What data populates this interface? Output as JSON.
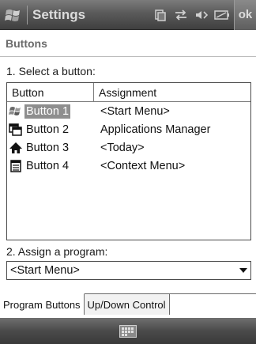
{
  "titlebar": {
    "title": "Settings",
    "ok_label": "ok",
    "icons": [
      "windows-flag-icon",
      "connectivity-icon",
      "data-sync-icon",
      "speaker-icon",
      "battery-icon"
    ]
  },
  "page": {
    "header": "Buttons",
    "select_label": "1. Select a button:",
    "assign_label": "2. Assign a program:"
  },
  "list": {
    "columns": [
      "Button",
      "Assignment"
    ],
    "rows": [
      {
        "name": "Button 1",
        "assignment": "<Start Menu>",
        "icon": "windows-flag-icon",
        "selected": true
      },
      {
        "name": "Button 2",
        "assignment": "Applications Manager",
        "icon": "windows-stack-icon",
        "selected": false
      },
      {
        "name": "Button 3",
        "assignment": "<Today>",
        "icon": "home-icon",
        "selected": false
      },
      {
        "name": "Button 4",
        "assignment": "<Context Menu>",
        "icon": "menu-list-icon",
        "selected": false
      }
    ]
  },
  "dropdown": {
    "value": "<Start Menu>"
  },
  "tabs": [
    {
      "label": "Program Buttons",
      "active": true
    },
    {
      "label": "Up/Down Control",
      "active": false
    }
  ],
  "bottombar": {
    "icon": "keyboard-icon"
  },
  "colors": {
    "titlebar": "#5a5a5a",
    "selection": "#8e8e8e"
  }
}
